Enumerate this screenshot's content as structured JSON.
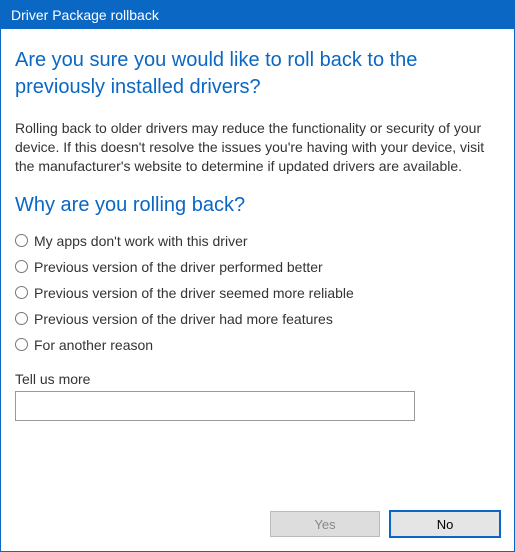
{
  "window": {
    "title": "Driver Package rollback"
  },
  "heading": "Are you sure you would like to roll back to the previously installed drivers?",
  "description": "Rolling back to older drivers may reduce the functionality or security of your device.  If this doesn't resolve the issues you're having with your device, visit the manufacturer's website to determine if updated drivers are available.",
  "subheading": "Why are you rolling back?",
  "reasons": [
    {
      "label": "My apps don't work with this driver"
    },
    {
      "label": "Previous version of the driver performed better"
    },
    {
      "label": "Previous version of the driver seemed more reliable"
    },
    {
      "label": "Previous version of the driver had more features"
    },
    {
      "label": "For another reason"
    }
  ],
  "tellmore": {
    "label": "Tell us more",
    "value": ""
  },
  "buttons": {
    "yes": "Yes",
    "no": "No"
  }
}
